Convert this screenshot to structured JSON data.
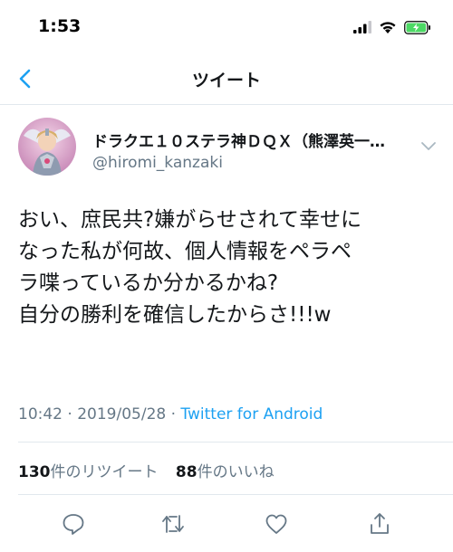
{
  "status_bar": {
    "time": "1:53",
    "icons": [
      "signal-icon",
      "wifi-icon",
      "battery-icon"
    ],
    "battery_color": "#4cd964"
  },
  "nav": {
    "title": "ツイート",
    "back_icon": "chevron-left-icon",
    "accent": "#1da1f2"
  },
  "tweet": {
    "author": {
      "display_name": "ドラクエ１０ステラ神ＤＱＸ（熊澤英一…",
      "handle": "@hiromi_kanzaki"
    },
    "text_lines": [
      "おい、庶民共?嫌がらせされて幸せに",
      "なった私が何故、個人情報をペラペ",
      "ラ喋っているか分かるかね?",
      "自分の勝利を確信したからさ!!!w"
    ],
    "time": "10:42",
    "separator": "·",
    "date": "2019/05/28",
    "source": "Twitter for Android",
    "retweets": {
      "count": "130",
      "label": "件のリツイート"
    },
    "likes": {
      "count": "88",
      "label": "件のいいね"
    }
  },
  "actions": [
    "reply-icon",
    "retweet-icon",
    "like-icon",
    "share-icon"
  ]
}
